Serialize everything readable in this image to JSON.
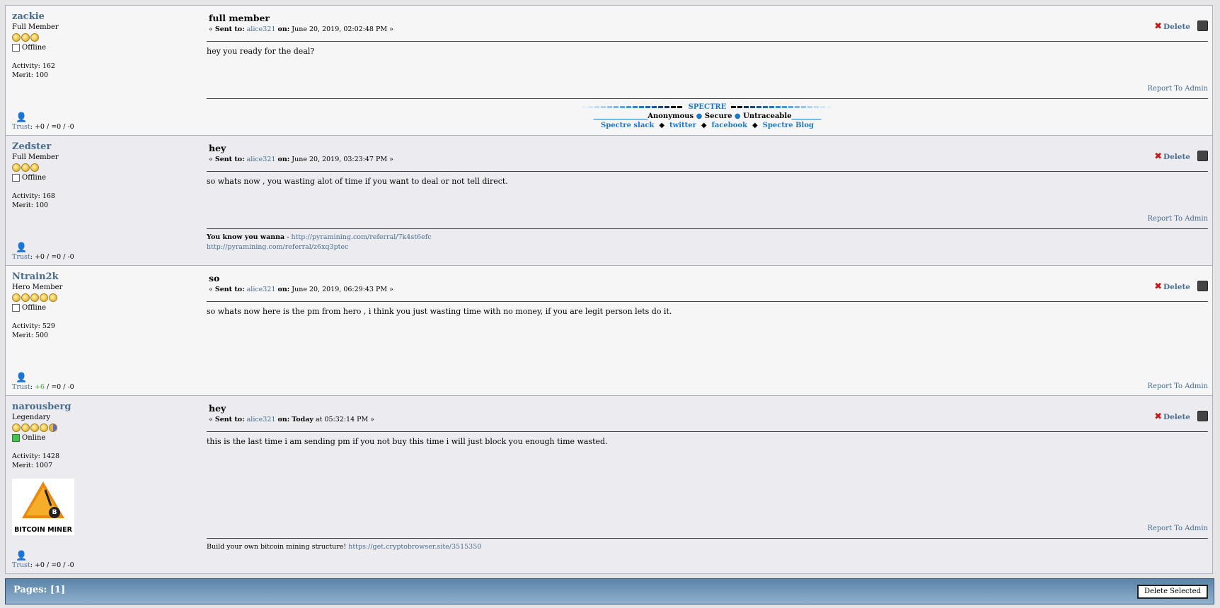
{
  "messages": [
    {
      "user": "zackie",
      "rank": "Full Member",
      "stars": 3,
      "half": false,
      "status": "Offline",
      "online": false,
      "activity": "Activity: 162",
      "merit": "Merit: 100",
      "trust_label": "Trust",
      "trust_pos": "+0",
      "trust_neu": "=0",
      "trust_neg": "-0",
      "trust_sep": " / ",
      "subject": "full member",
      "sent_to_label": "Sent to:",
      "recipient": "alice321",
      "on_label": "on:",
      "date": "June 20, 2019, 02:02:48 PM",
      "body": "hey you ready for the deal?",
      "delete": "Delete",
      "report": "Report To Admin"
    },
    {
      "user": "Zedster",
      "rank": "Full Member",
      "stars": 3,
      "half": false,
      "status": "Offline",
      "online": false,
      "activity": "Activity: 168",
      "merit": "Merit: 100",
      "trust_label": "Trust",
      "trust_pos": "+0",
      "trust_neu": "=0",
      "trust_neg": "-0",
      "trust_sep": " / ",
      "subject": "hey",
      "sent_to_label": "Sent to:",
      "recipient": "alice321",
      "on_label": "on:",
      "date": "June 20, 2019, 03:23:47 PM",
      "body": "so whats now , you wasting alot of time if you want to deal or not tell direct.",
      "delete": "Delete",
      "report": "Report To Admin"
    },
    {
      "user": "Ntrain2k",
      "rank": "Hero Member",
      "stars": 5,
      "half": false,
      "status": "Offline",
      "online": false,
      "activity": "Activity: 529",
      "merit": "Merit: 500",
      "trust_label": "Trust",
      "trust_pos": "+6",
      "trust_neu": "=0",
      "trust_neg": "-0",
      "trust_sep": " / ",
      "subject": "so",
      "sent_to_label": "Sent to:",
      "recipient": "alice321",
      "on_label": "on:",
      "date": "June 20, 2019, 06:29:43 PM",
      "body": "so whats now here is the pm from hero , i think you just wasting time with no money, if you are legit person lets do it.",
      "delete": "Delete",
      "report": "Report To Admin"
    },
    {
      "user": "narousberg",
      "rank": "Legendary",
      "stars": 4,
      "half": true,
      "status": "Online",
      "online": true,
      "activity": "Activity: 1428",
      "merit": "Merit: 1007",
      "trust_label": "Trust",
      "trust_pos": "+0",
      "trust_neu": "=0",
      "trust_neg": "-0",
      "trust_sep": " / ",
      "subject": "hey",
      "sent_to_label": "Sent to:",
      "recipient": "alice321",
      "on_label": "on:",
      "date_bold": "Today",
      "date": "at 05:32:14 PM",
      "body": "this is the last time i am sending pm if you not buy this time i will just block you enough time wasted.",
      "delete": "Delete",
      "report": "Report To Admin",
      "avatar_label": "BITCOIN MINER"
    }
  ],
  "signatures": {
    "spectre": {
      "title": "SPECTRE",
      "line2": [
        "Anonymous",
        "Secure",
        "Untraceable"
      ],
      "links": [
        "Spectre slack",
        "twitter",
        "facebook",
        "Spectre Blog"
      ]
    },
    "zedster": {
      "lead": "You know you wanna",
      "sep": " - ",
      "link1": "http://pyramining.com/referral/7k4st6efc",
      "link2": "http://pyramining.com/referral/z6xq3ptec"
    },
    "narousberg": {
      "text": "Build your own bitcoin mining structure!",
      "link": "https://get.cryptobrowser.site/3515350"
    }
  },
  "footer": {
    "pages": "Pages: [1]",
    "delete_selected": "Delete Selected"
  },
  "colors": {
    "link": "#476c8e",
    "bar": "#5b84a8",
    "positive": "#3aa233"
  }
}
